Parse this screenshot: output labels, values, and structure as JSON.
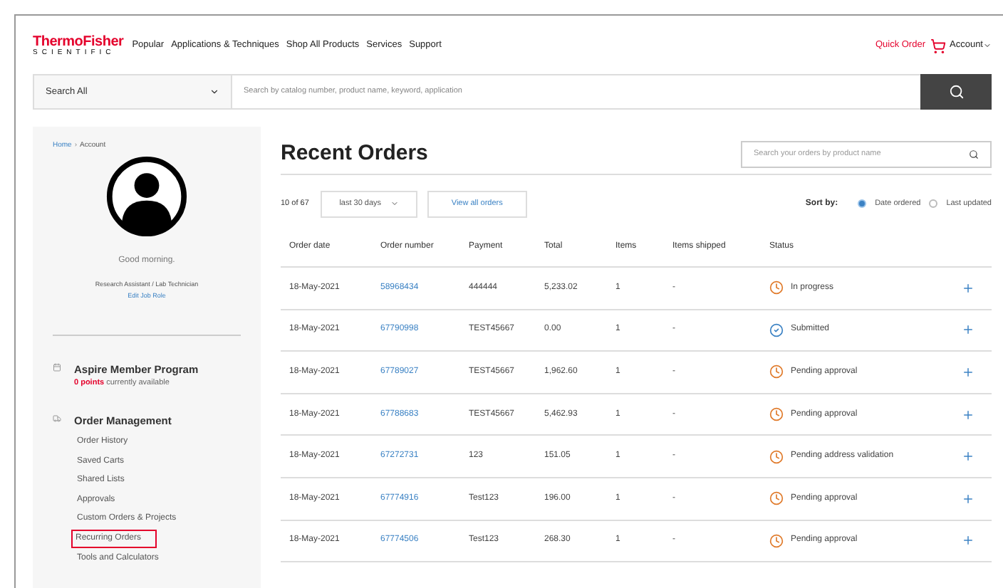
{
  "logo": {
    "top": "ThermoFisher",
    "bottom": "SCIENTIFIC"
  },
  "nav": [
    "Popular",
    "Applications & Techniques",
    "Shop All Products",
    "Services",
    "Support"
  ],
  "quick_order": "Quick Order",
  "account": "Account",
  "search": {
    "scope": "Search All",
    "placeholder": "Search by catalog number, product name, keyword, application"
  },
  "breadcrumb": [
    "Home",
    "›",
    "Account"
  ],
  "greeting": "Good morning.",
  "job_role": "Research Assistant / Lab Technician",
  "edit_job_role": "Edit Job Role",
  "program": {
    "title": "Aspire Member Program",
    "points": "0 points",
    "points_suffix": "currently available"
  },
  "order_management": {
    "title": "Order Management",
    "items": [
      {
        "label": "Order History",
        "highlighted": false
      },
      {
        "label": "Saved Carts",
        "highlighted": false
      },
      {
        "label": "Shared Lists",
        "highlighted": false
      },
      {
        "label": "Approvals",
        "highlighted": false
      },
      {
        "label": "Custom Orders & Projects",
        "highlighted": false
      },
      {
        "label": "Recurring Orders",
        "highlighted": true
      },
      {
        "label": "Tools and Calculators",
        "highlighted": false
      }
    ]
  },
  "main": {
    "title": "Recent Orders",
    "search_placeholder": "Search your orders by product name",
    "count": "10 of 67",
    "range": "last 30 days",
    "view_all": "View all orders",
    "sort_label": "Sort by:",
    "sort_options": [
      {
        "label": "Date ordered",
        "selected": true
      },
      {
        "label": "Last updated",
        "selected": false
      }
    ]
  },
  "table": {
    "columns": [
      "Order date",
      "Order number",
      "Payment",
      "Total",
      "Items",
      "Items shipped",
      "Status"
    ],
    "rows": [
      {
        "date": "18-May-2021",
        "number": "58968434",
        "payment": "444444",
        "total": "5,233.02",
        "items": "1",
        "shipped": "-",
        "status": "In progress",
        "kind": "pending"
      },
      {
        "date": "18-May-2021",
        "number": "67790998",
        "payment": "TEST45667",
        "total": "0.00",
        "items": "1",
        "shipped": "-",
        "status": "Submitted",
        "kind": "submitted"
      },
      {
        "date": "18-May-2021",
        "number": "67789027",
        "payment": "TEST45667",
        "total": "1,962.60",
        "items": "1",
        "shipped": "-",
        "status": "Pending approval",
        "kind": "pending"
      },
      {
        "date": "18-May-2021",
        "number": "67788683",
        "payment": "TEST45667",
        "total": "5,462.93",
        "items": "1",
        "shipped": "-",
        "status": "Pending approval",
        "kind": "pending"
      },
      {
        "date": "18-May-2021",
        "number": "67272731",
        "payment": "123",
        "total": "151.05",
        "items": "1",
        "shipped": "-",
        "status": "Pending address validation",
        "kind": "pending"
      },
      {
        "date": "18-May-2021",
        "number": "67774916",
        "payment": "Test123",
        "total": "196.00",
        "items": "1",
        "shipped": "-",
        "status": "Pending approval",
        "kind": "pending"
      },
      {
        "date": "18-May-2021",
        "number": "67774506",
        "payment": "Test123",
        "total": "268.30",
        "items": "1",
        "shipped": "-",
        "status": "Pending approval",
        "kind": "pending"
      }
    ]
  }
}
